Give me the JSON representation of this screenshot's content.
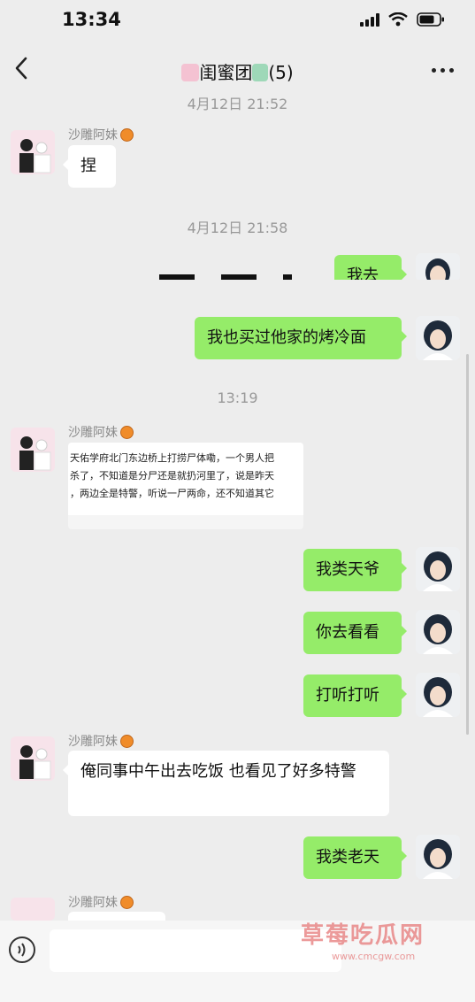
{
  "status": {
    "time": "13:34"
  },
  "header": {
    "title": "闺蜜团",
    "count": "(5)"
  },
  "timestamps": {
    "t1": "4月12日 21:52",
    "t2": "4月12日 21:58",
    "t3": "13:19"
  },
  "sender_name": "沙雕阿妹",
  "messages": {
    "m1": "捏",
    "m2": "我去",
    "m3": "我也买过他家的烤冷面",
    "m4": "我类天爷",
    "m5": "你去看看",
    "m6": "打听打听",
    "m7": "俺同事中午出去吃饭 也看见了好多特警",
    "m8": "我类老天"
  },
  "quote": {
    "line1": "天佑学府北门东边桥上打捞尸体嘞，一个男人把",
    "line2": "杀了，不知道是分尸还是就扔河里了，说是昨天",
    "line3": "，两边全是特警，听说一尸两命，还不知道其它"
  },
  "watermark": {
    "text": "草莓吃瓜网",
    "url": "www.cmcgw.com"
  },
  "colors": {
    "background": "#ededed",
    "bubble_right": "#95ec69",
    "bubble_left": "#ffffff"
  }
}
